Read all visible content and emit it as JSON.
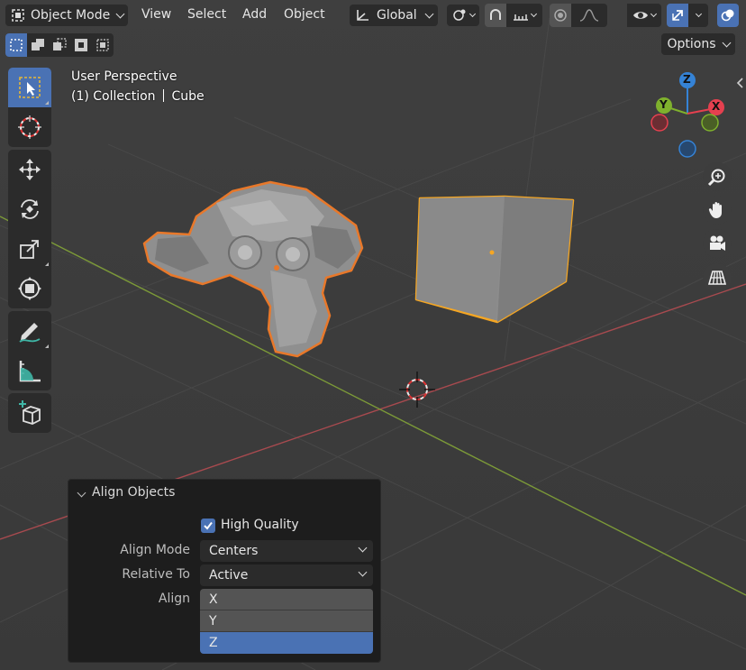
{
  "header": {
    "mode_label": "Object Mode",
    "menus": [
      "View",
      "Select",
      "Add",
      "Object"
    ],
    "orientation_label": "Global"
  },
  "options_label": "Options",
  "viewport": {
    "view_name": "User Perspective",
    "collection_label": "(1) Collection",
    "active_object": "Cube"
  },
  "gizmo": {
    "z_label": "Z",
    "y_label": "Y",
    "x_label": "X"
  },
  "colors": {
    "accent": "#4a72b4",
    "selection_orange": "#e8782a",
    "active_outline": "#f5a623",
    "axis_x": "#e5404f",
    "axis_y": "#7fb12d",
    "axis_z": "#3583d6"
  },
  "panel": {
    "title": "Align Objects",
    "high_quality_label": "High Quality",
    "high_quality_checked": true,
    "align_mode_label": "Align Mode",
    "align_mode_value": "Centers",
    "relative_to_label": "Relative To",
    "relative_to_value": "Active",
    "align_label": "Align",
    "align_options": [
      "X",
      "Y",
      "Z"
    ],
    "align_selected": "Z"
  },
  "icons": {
    "tools": [
      "select-box-icon",
      "cursor-icon",
      "move-icon",
      "rotate-icon",
      "scale-icon",
      "transform-icon",
      "annotate-icon",
      "measure-icon",
      "add-cube-icon"
    ],
    "nav": [
      "zoom-icon",
      "hand-pan-icon",
      "camera-icon",
      "grid-ortho-icon"
    ]
  }
}
